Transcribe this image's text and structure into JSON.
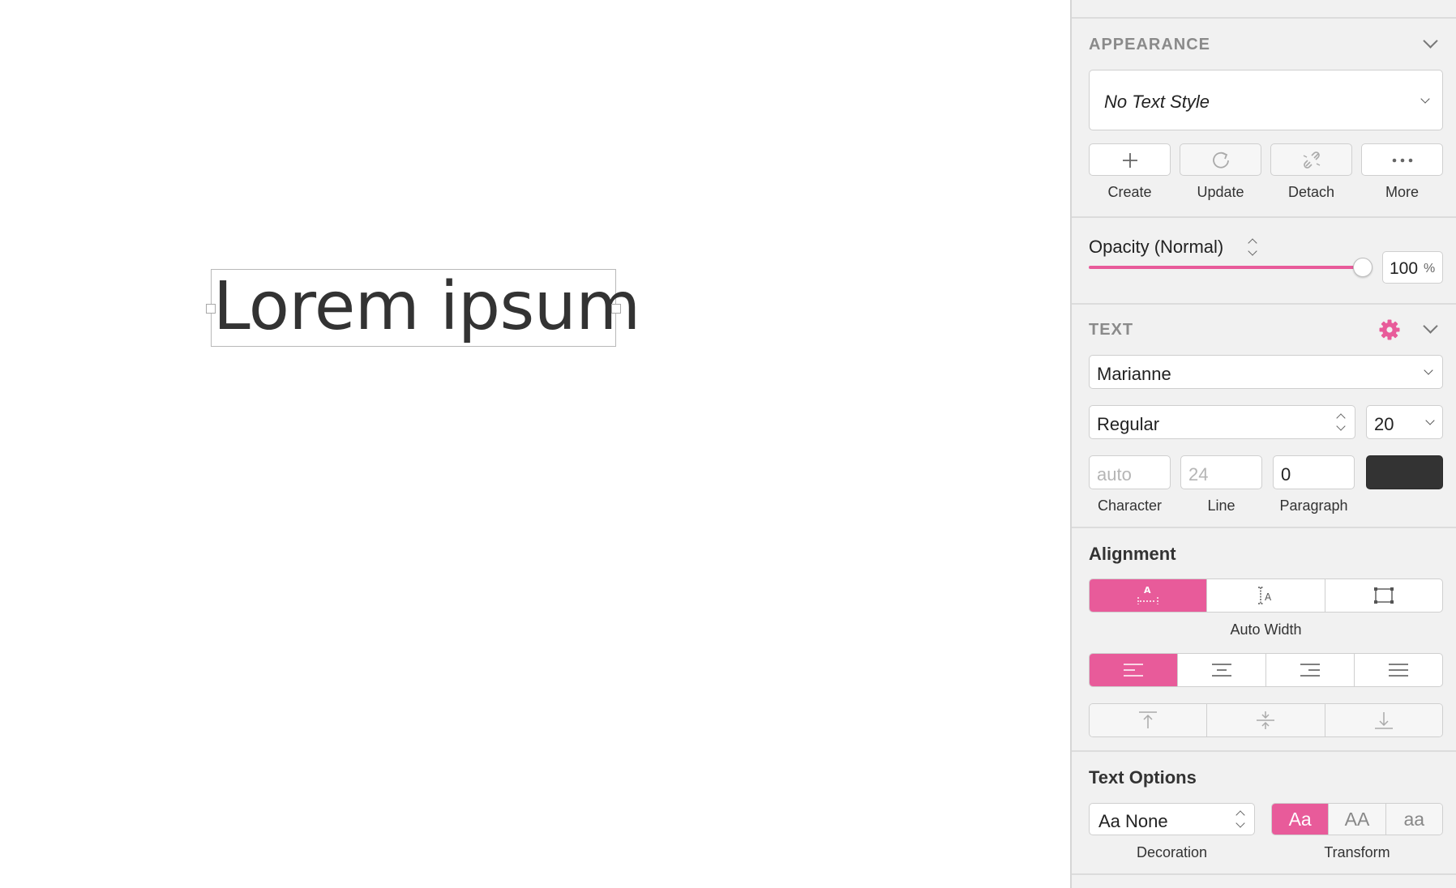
{
  "canvas": {
    "text": "Lorem ipsum"
  },
  "appearance": {
    "title": "APPEARANCE",
    "text_style": "No Text Style",
    "actions": [
      {
        "label": "Create",
        "icon": "plus-icon"
      },
      {
        "label": "Update",
        "icon": "refresh-icon"
      },
      {
        "label": "Detach",
        "icon": "detach-link-icon"
      },
      {
        "label": "More",
        "icon": "more-icon"
      }
    ],
    "opacity_label": "Opacity (Normal)",
    "opacity_value": "100",
    "opacity_unit": "%",
    "opacity_fraction": 1.0
  },
  "text": {
    "title": "TEXT",
    "font_family": "Marianne",
    "font_weight": "Regular",
    "font_size": "20",
    "character_placeholder": "auto",
    "line_placeholder": "24",
    "paragraph_value": "0",
    "character_label": "Character",
    "line_label": "Line",
    "paragraph_label": "Paragraph",
    "color": "#333333"
  },
  "alignment": {
    "title": "Alignment",
    "width_mode_label": "Auto Width",
    "width_modes": [
      "auto-width-icon",
      "auto-height-icon",
      "fixed-size-icon"
    ],
    "horizontal": [
      "align-left-icon",
      "align-center-icon",
      "align-right-icon",
      "align-justify-icon"
    ],
    "vertical": [
      "align-top-icon",
      "align-middle-icon",
      "align-bottom-icon"
    ]
  },
  "text_options": {
    "title": "Text Options",
    "decoration_value": "Aa None",
    "decoration_label": "Decoration",
    "transform_label": "Transform",
    "transforms": [
      "Aa",
      "AA",
      "aa"
    ]
  },
  "colors": {
    "accent": "#e85b9a",
    "panel": "#f1f1f1"
  }
}
